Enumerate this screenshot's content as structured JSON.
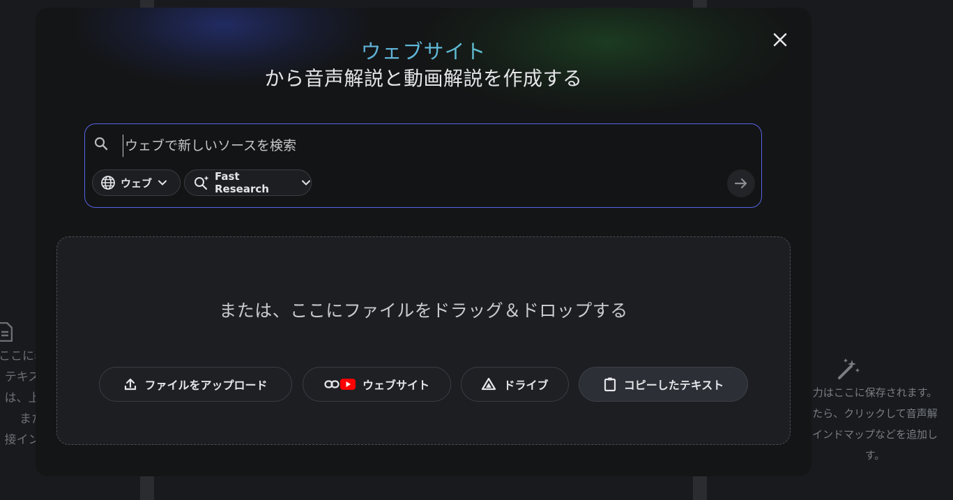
{
  "background": {
    "left_text_lines": [
      "ここに表",
      "テキス",
      "は、上",
      "また",
      "接イン"
    ],
    "right_text_lines": [
      "力はここに保存されます。",
      "たら、クリックして音声解",
      "インドマップなどを追加し",
      "す。"
    ]
  },
  "modal": {
    "title_highlight": "ウェブサイト",
    "title_rest": "から音声解説と動画解説を作成する",
    "close_icon": "close-icon",
    "search": {
      "placeholder": "ウェブで新しいソースを検索",
      "value": "",
      "source_chip_label": "ウェブ",
      "mode_chip_label": "Fast Research"
    },
    "drop_zone": {
      "text": "または、ここにファイルをドラッグ＆ドロップする",
      "buttons": [
        {
          "label": "ファイルをアップロード",
          "icon": "upload-icon"
        },
        {
          "label": "ウェブサイト",
          "icon": "link-youtube-icon"
        },
        {
          "label": "ドライブ",
          "icon": "drive-icon"
        },
        {
          "label": "コピーしたテキスト",
          "icon": "clipboard-icon"
        }
      ]
    }
  },
  "colors": {
    "accent_border": "#5565e8",
    "youtube_red": "#ff0000",
    "title_gradient_start": "#6d8ff0",
    "title_gradient_end": "#67d89a"
  }
}
